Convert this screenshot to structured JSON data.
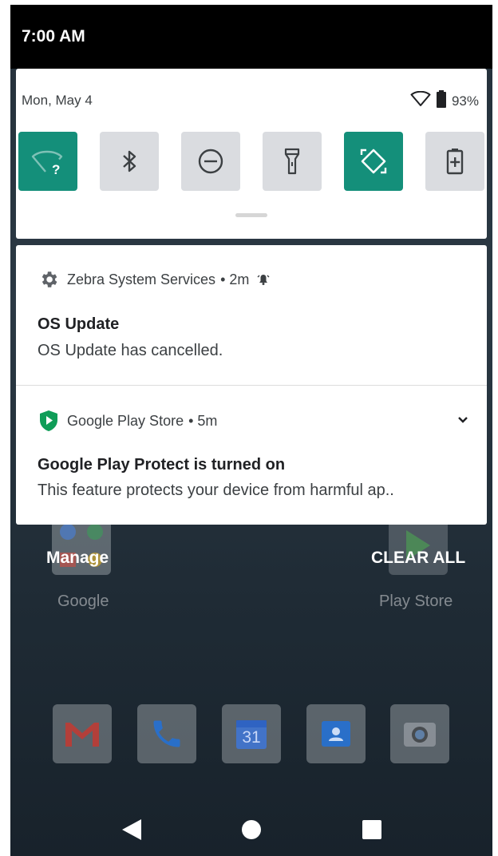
{
  "status_bar": {
    "time": "7:00 AM"
  },
  "quick_settings": {
    "date": "Mon, May 4",
    "battery_percent": "93%",
    "tiles": [
      {
        "name": "wifi",
        "icon": "wifi-unknown-icon",
        "active": true
      },
      {
        "name": "bluetooth",
        "icon": "bluetooth-icon",
        "active": false
      },
      {
        "name": "do-not-disturb",
        "icon": "dnd-icon",
        "active": false
      },
      {
        "name": "flashlight",
        "icon": "flashlight-icon",
        "active": false
      },
      {
        "name": "auto-rotate",
        "icon": "rotate-icon",
        "active": true
      },
      {
        "name": "battery-saver",
        "icon": "battery-saver-icon",
        "active": false
      }
    ]
  },
  "notifications": [
    {
      "app": "Zebra System Services",
      "time": "• 2m",
      "title": "OS Update",
      "body": "OS Update has cancelled."
    },
    {
      "app": "Google Play Store",
      "time": "• 5m",
      "title": "Google Play Protect is turned on",
      "body": "This feature protects your device from harmful ap.."
    }
  ],
  "shade_actions": {
    "manage": "Manage",
    "clear_all": "CLEAR ALL"
  },
  "home": {
    "labels": {
      "google": "Google",
      "play_store": "Play Store"
    },
    "dock": [
      "gmail-icon",
      "phone-icon",
      "calendar-icon",
      "contacts-icon",
      "camera-icon"
    ],
    "calendar_day": "31"
  },
  "colors": {
    "accent": "#148f7a",
    "tile_off": "#dadce0",
    "play_protect": "#0f9d58"
  }
}
